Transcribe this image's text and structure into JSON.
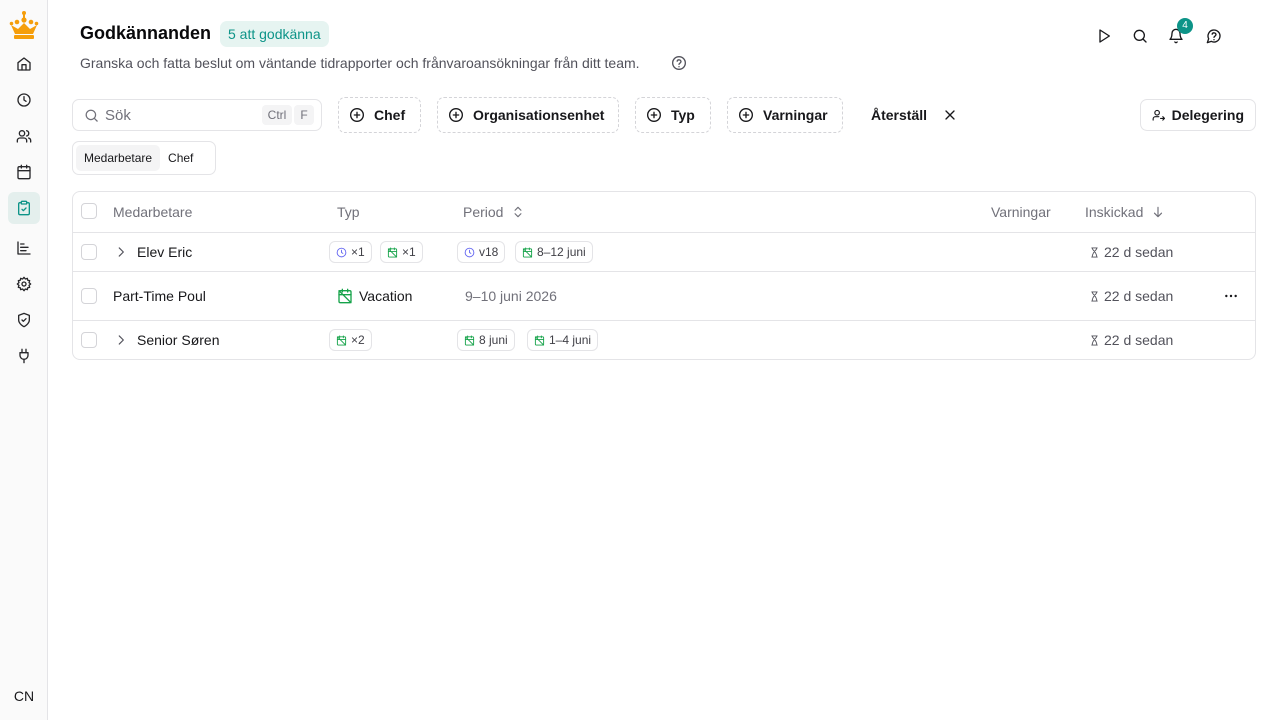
{
  "sidebar": {
    "logo": "crown-logo",
    "items": [
      {
        "name": "home",
        "icon": "home-icon"
      },
      {
        "name": "time",
        "icon": "clock-icon"
      },
      {
        "name": "team",
        "icon": "users-icon"
      },
      {
        "name": "calendar",
        "icon": "calendar-icon"
      },
      {
        "name": "approvals",
        "icon": "clipboard-check-icon",
        "active": true
      },
      {
        "name": "reports",
        "icon": "bar-chart-icon"
      },
      {
        "name": "settings",
        "icon": "gear-icon"
      },
      {
        "name": "security",
        "icon": "shield-icon"
      },
      {
        "name": "integrations",
        "icon": "plug-icon"
      }
    ],
    "user_initials": "CN"
  },
  "header": {
    "title": "Godkännanden",
    "badge": "5 att godkänna",
    "subtitle": "Granska och fatta beslut om väntande tidrapporter och frånvaroansökningar från ditt team.",
    "notification_count": "4"
  },
  "toolbar": {
    "search_placeholder": "Sök",
    "shortcut_ctrl": "Ctrl",
    "shortcut_key": "F",
    "filters": [
      "Chef",
      "Organisationsenhet",
      "Typ",
      "Varningar"
    ],
    "reset_label": "Återställ",
    "delegation_label": "Delegering"
  },
  "view_toggle": {
    "options": [
      "Medarbetare",
      "Chef"
    ],
    "selected": "Medarbetare"
  },
  "table": {
    "columns": {
      "employee": "Medarbetare",
      "type": "Typ",
      "period": "Period",
      "warnings": "Varningar",
      "submitted": "Inskickad"
    },
    "rows": [
      {
        "name": "Elev Eric",
        "type_chips": [
          "×1",
          "×1"
        ],
        "period_chips": [
          "v18",
          "8–12 juni"
        ],
        "submitted": "22 d sedan"
      },
      {
        "name": "Part-Time Poul",
        "type_label": "Vacation",
        "period": "9–10 juni 2026",
        "submitted": "22 d sedan"
      },
      {
        "name": "Senior Søren",
        "type_chips": [
          "×2"
        ],
        "period_chips": [
          "8 juni",
          "1–4 juni"
        ],
        "submitted": "22 d sedan"
      }
    ]
  },
  "colors": {
    "accent": "#0d9488",
    "timesheet_icon": "#6366f1",
    "absence_icon": "#16a34a"
  }
}
